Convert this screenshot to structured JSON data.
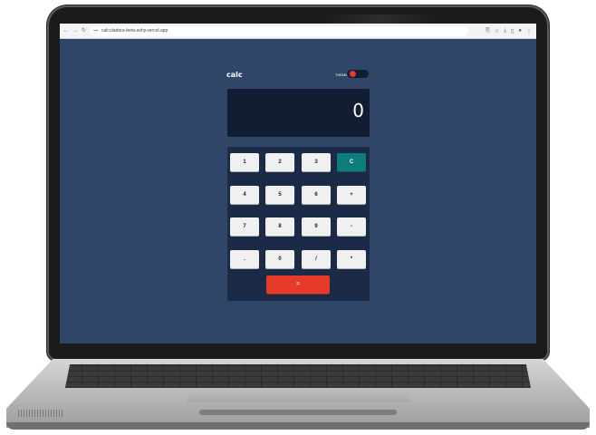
{
  "browser": {
    "back_icon": "←",
    "forward_icon": "→",
    "reload_icon": "↻",
    "url_icon": "⊶",
    "url": "calculadora-beta-ashy.vercel.app",
    "icons": [
      "translate-icon",
      "star-icon",
      "download-icon",
      "tab-icon",
      "profile-icon",
      "menu-icon"
    ],
    "icon_glyphs": [
      "⎘",
      "☆",
      "⤓",
      "▯",
      "●",
      "⋮"
    ]
  },
  "app": {
    "title": "calc",
    "theme_label": "THEME",
    "display_value": "0",
    "keys": [
      {
        "label": "1"
      },
      {
        "label": "2"
      },
      {
        "label": "3"
      },
      {
        "label": "C"
      },
      {
        "label": "4"
      },
      {
        "label": "5"
      },
      {
        "label": "6"
      },
      {
        "label": "+"
      },
      {
        "label": "7"
      },
      {
        "label": "8"
      },
      {
        "label": "9"
      },
      {
        "label": "-"
      },
      {
        "label": "."
      },
      {
        "label": "0"
      },
      {
        "label": "/"
      },
      {
        "label": "*"
      }
    ],
    "equals_label": "=",
    "colors": {
      "background": "#2f4668",
      "display": "#121c33",
      "keypad": "#1b2b47",
      "clear_key": "#0e7c7b",
      "equals_key": "#e63a2b",
      "toggle_knob": "#e63a2b"
    }
  }
}
